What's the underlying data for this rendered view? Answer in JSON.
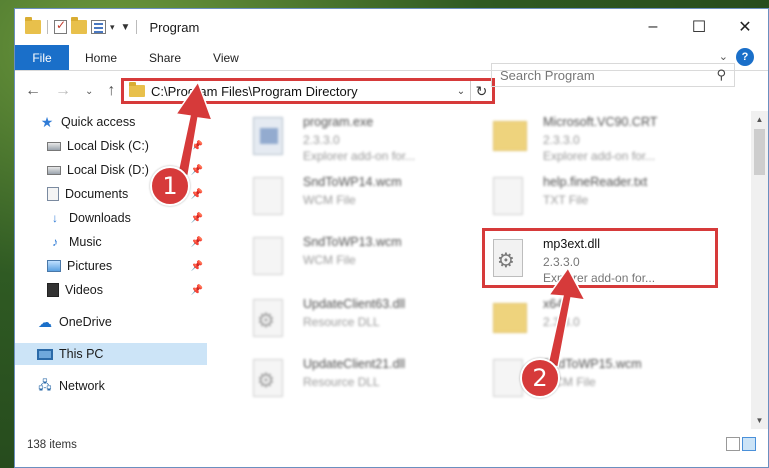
{
  "window": {
    "title": "Program"
  },
  "ribbon": {
    "tabs": [
      "File",
      "Home",
      "Share",
      "View"
    ],
    "help": "?"
  },
  "address": {
    "path": "C:\\Program Files\\Program Directory"
  },
  "search": {
    "placeholder": "Search Program"
  },
  "sidebar": {
    "items": [
      {
        "label": "Quick access",
        "icon": "star-icon"
      },
      {
        "label": "Local Disk (C:)",
        "icon": "disk-icon"
      },
      {
        "label": "Local Disk (D:)",
        "icon": "disk-icon"
      },
      {
        "label": "Documents",
        "icon": "documents-icon"
      },
      {
        "label": "Downloads",
        "icon": "downloads-icon"
      },
      {
        "label": "Music",
        "icon": "music-icon"
      },
      {
        "label": "Pictures",
        "icon": "pictures-icon"
      },
      {
        "label": "Videos",
        "icon": "videos-icon"
      },
      {
        "label": "OneDrive",
        "icon": "cloud-icon"
      },
      {
        "label": "This PC",
        "icon": "computer-icon"
      },
      {
        "label": "Network",
        "icon": "network-icon"
      }
    ]
  },
  "files": [
    {
      "name": "program.exe",
      "line2": "2.3.3.0",
      "line3": "Explorer add-on for..."
    },
    {
      "name": "Microsoft.VC90.CRT",
      "line2": "2.3.3.0",
      "line3": "Explorer add-on for..."
    },
    {
      "name": "SndToWP14.wcm",
      "line2": "WCM File",
      "line3": ""
    },
    {
      "name": "help.fineReader.txt",
      "line2": "TXT File",
      "line3": ""
    },
    {
      "name": "SndToWP13.wcm",
      "line2": "WCM File",
      "line3": ""
    },
    {
      "name": "mp3ext.dll",
      "line2": "2.3.3.0",
      "line3": "Explorer add-on for..."
    },
    {
      "name": "UpdateClient63.dll",
      "line2": "Resource DLL",
      "line3": ""
    },
    {
      "name": "x64",
      "line2": "2.3.3.0",
      "line3": ""
    },
    {
      "name": "UpdateClient21.dll",
      "line2": "Resource DLL",
      "line3": ""
    },
    {
      "name": "SndToWP15.wcm",
      "line2": "WCM File",
      "line3": ""
    }
  ],
  "status": {
    "item_count": "138 items"
  },
  "callouts": {
    "one": "1",
    "two": "2"
  }
}
